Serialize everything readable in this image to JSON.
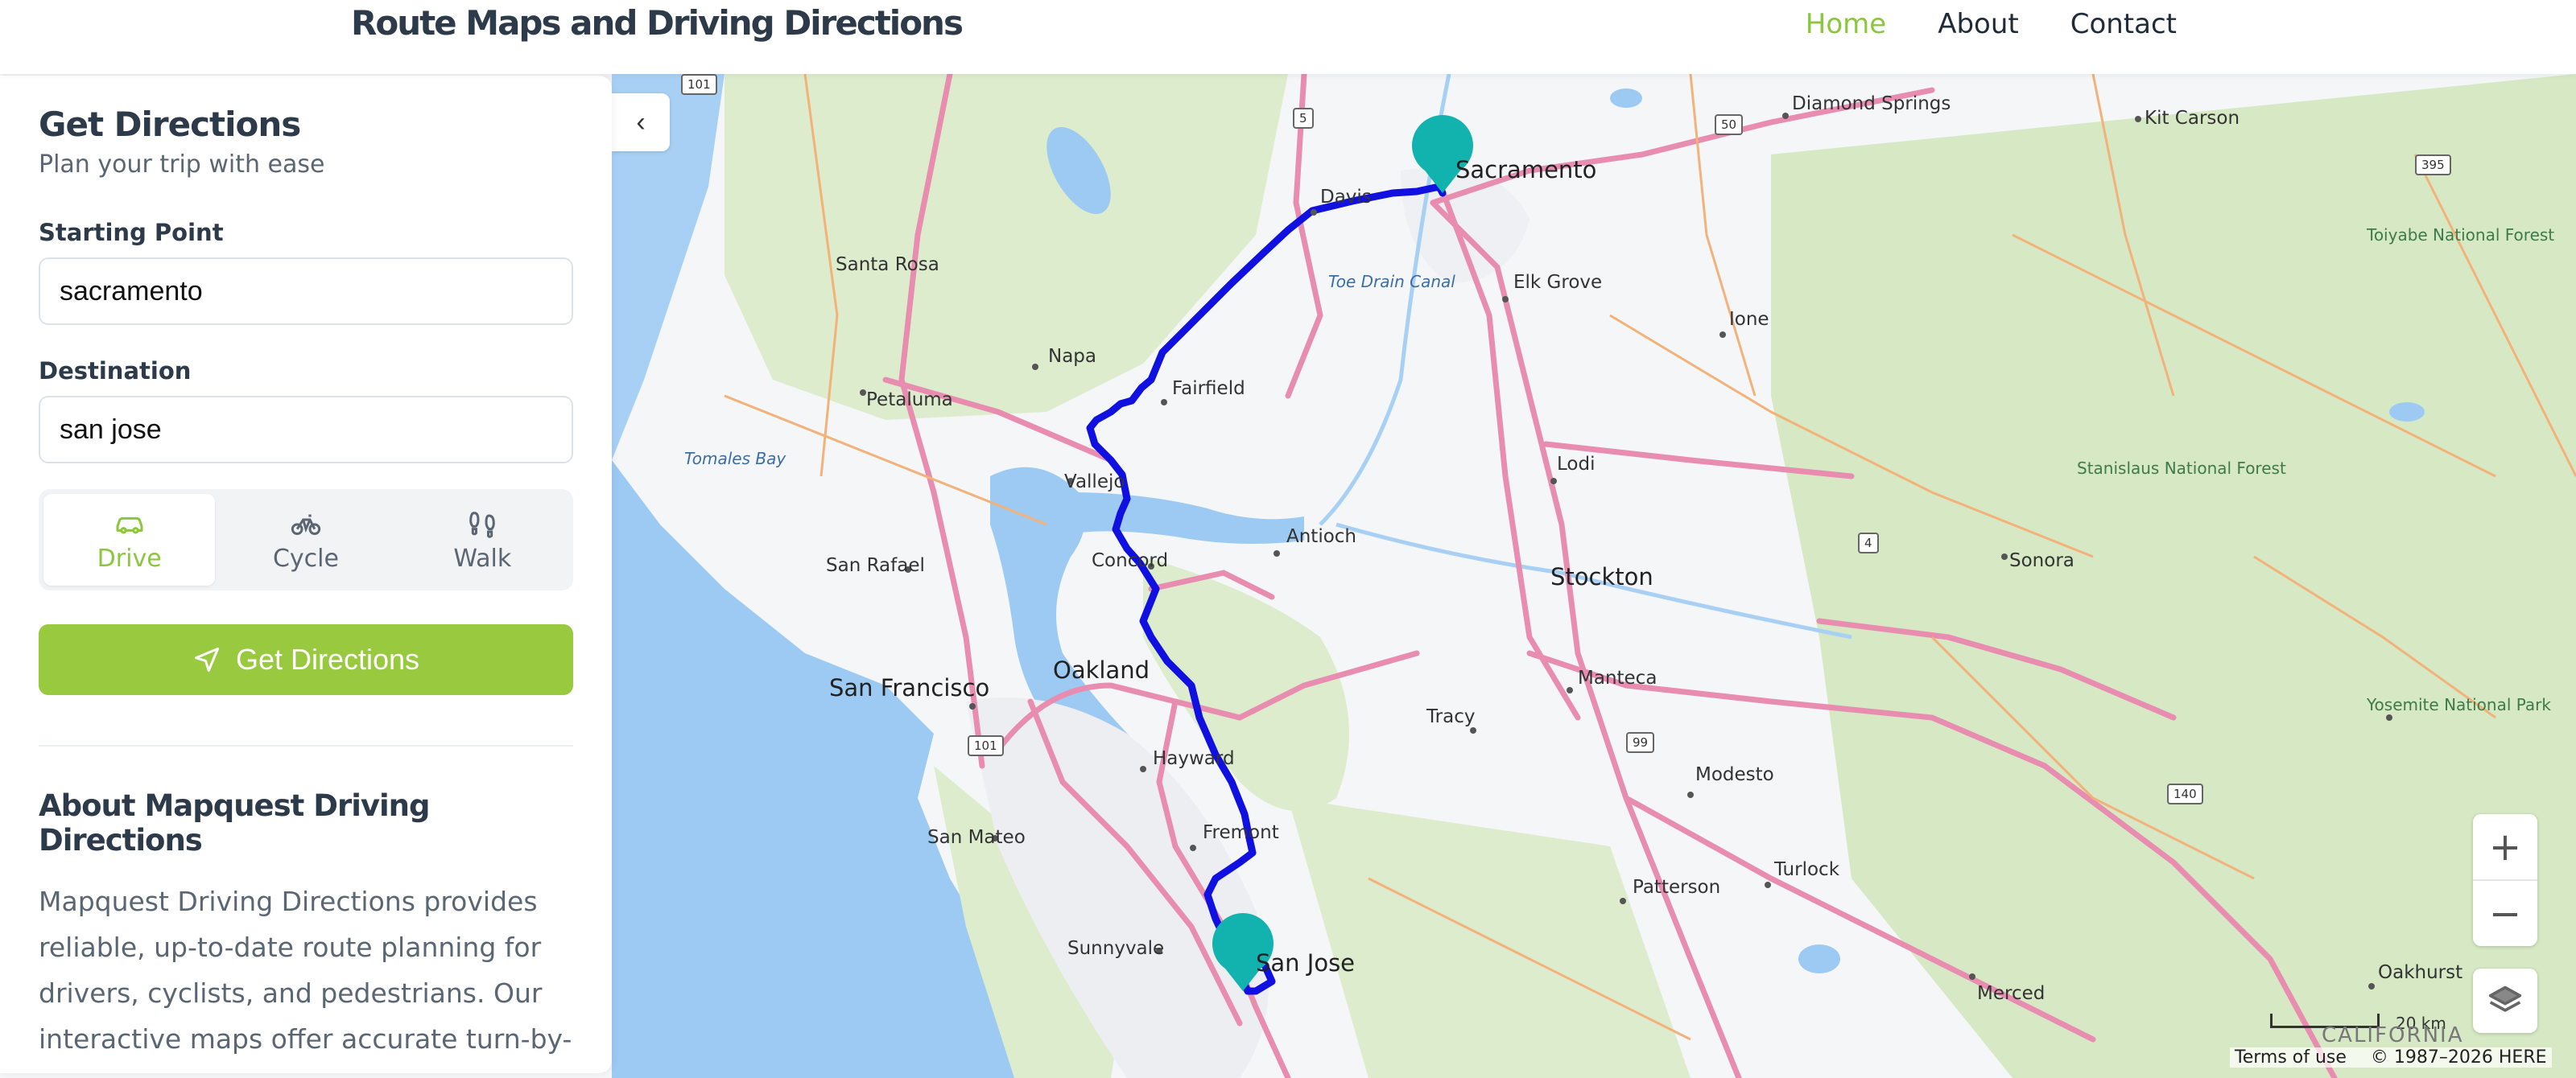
{
  "header": {
    "title": "Route Maps and Driving Directions",
    "nav": [
      {
        "label": "Home",
        "active": true
      },
      {
        "label": "About",
        "active": false
      },
      {
        "label": "Contact",
        "active": false
      }
    ]
  },
  "sidebar": {
    "title": "Get Directions",
    "subtitle": "Plan your trip with ease",
    "start_label": "Starting Point",
    "start_value": "sacramento",
    "dest_label": "Destination",
    "dest_value": "san jose",
    "modes": [
      {
        "label": "Drive",
        "icon": "car-icon",
        "active": true
      },
      {
        "label": "Cycle",
        "icon": "bicycle-icon",
        "active": false
      },
      {
        "label": "Walk",
        "icon": "footprints-icon",
        "active": false
      }
    ],
    "submit_label": "Get Directions",
    "about_title": "About Mapquest Driving Directions",
    "about_text": "Mapquest Driving Directions provides reliable, up-to-date route planning for drivers, cyclists, and pedestrians. Our interactive maps offer accurate turn-by-turn navigation, helping you find the"
  },
  "map": {
    "collapse_icon": "‹",
    "zoom_in": "+",
    "zoom_out": "−",
    "scale_label": "20 km",
    "region_label": "CALIFORNIA",
    "terms": "Terms of use",
    "copyright": "© 1987–2026 HERE",
    "labels": {
      "sacramento": "Sacramento",
      "davis": "Davis",
      "elk_grove": "Elk Grove",
      "toe_drain": "Toe Drain Canal",
      "santa_rosa": "Santa Rosa",
      "napa": "Napa",
      "fairfield": "Fairfield",
      "petaluma": "Petaluma",
      "tomales": "Tomales Bay",
      "vallejo": "Vallejo",
      "antioch": "Antioch",
      "concord": "Concord",
      "san_rafael": "San Rafael",
      "stockton": "Stockton",
      "oakland": "Oakland",
      "san_francisco": "San Francisco",
      "manteca": "Manteca",
      "tracy": "Tracy",
      "hayward": "Hayward",
      "modesto": "Modesto",
      "fremont": "Fremont",
      "san_mateo": "San Mateo",
      "turlock": "Turlock",
      "patterson": "Patterson",
      "sunnyvale": "Sunnyvale",
      "san_jose": "San Jose",
      "merced": "Merced",
      "oakhurst": "Oakhurst",
      "ione": "Ione",
      "lodi": "Lodi",
      "sonora": "Sonora",
      "diamond_springs": "Diamond Springs",
      "kit_carson": "Kit Carson",
      "toiyabe": "Toiyabe National Forest",
      "stanislaus": "Stanislaus National Forest",
      "yosemite": "Yosemite National Park"
    },
    "shields": {
      "i5": "5",
      "us50": "50",
      "us101a": "101",
      "us101b": "101",
      "us395": "395",
      "sr4": "4",
      "sr99": "99",
      "sr140": "140"
    }
  }
}
